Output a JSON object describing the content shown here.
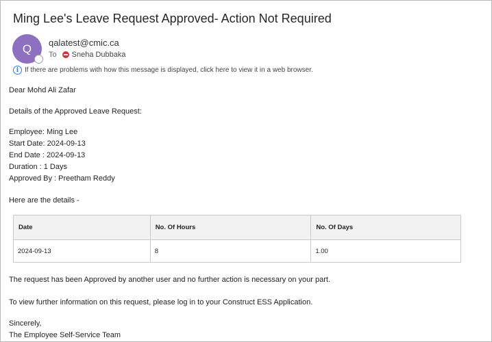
{
  "email": {
    "subject": "Ming Lee's Leave Request Approved- Action Not Required",
    "avatar_initial": "Q",
    "sender": "qalatest@cmic.ca",
    "to_label": "To",
    "recipient": "Sneha Dubbaka",
    "info_bar": "If there are problems with how this message is displayed, click here to view it in a web browser."
  },
  "body": {
    "greeting": "Dear Mohd Ali Zafar",
    "details_heading": "Details of the Approved Leave Request:",
    "employee": "Employee: Ming Lee",
    "start_date": "Start Date: 2024-09-13",
    "end_date": "End Date : 2024-09-13",
    "duration": "Duration : 1 Days",
    "approved_by": "Approved By : Preetham Reddy",
    "here_details": "Here are the details -",
    "approved_note": "The request has been Approved by another user and no further action is necessary on your part.",
    "view_further": "To view further information on this request, please log in to your Construct ESS Application.",
    "sign_off": "Sincerely,",
    "team": "The Employee Self-Service Team"
  },
  "table": {
    "headers": [
      "Date",
      "No. Of Hours",
      "No. Of Days"
    ],
    "rows": [
      [
        "2024-09-13",
        "8",
        "1.00"
      ]
    ]
  },
  "colors": {
    "avatar": "#8e6fc0",
    "blocked": "#d13438",
    "info": "#2b7cd3"
  }
}
